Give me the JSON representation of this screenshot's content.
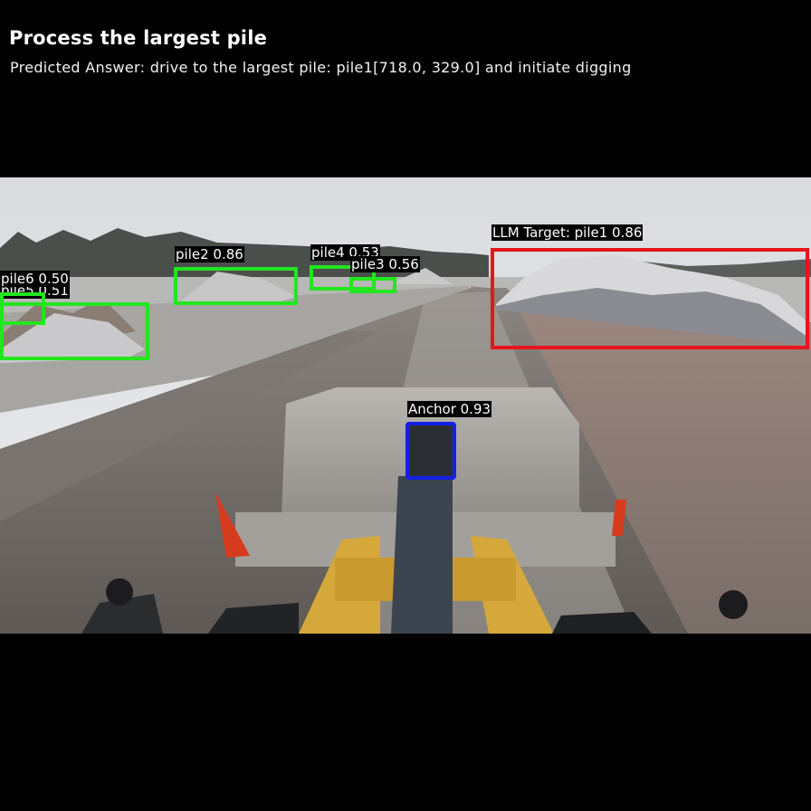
{
  "title": "Process the largest pile",
  "predicted_answer": "Predicted Answer: drive to the largest pile: pile1[718.0, 329.0] and initiate digging",
  "colors": {
    "target": "#e8141c",
    "pile": "#22e61e",
    "anchor": "#1420e8"
  },
  "detections": {
    "target": {
      "label": "LLM Target: pile1 0.86"
    },
    "pile2": {
      "label": "pile2 0.86"
    },
    "pile3": {
      "label": "pile3 0.56"
    },
    "pile4": {
      "label": "pile4 0.53"
    },
    "pile5": {
      "label": "pile5 0.51"
    },
    "pile6": {
      "label": "pile6 0.50"
    },
    "anchor": {
      "label": "Anchor 0.93"
    }
  }
}
